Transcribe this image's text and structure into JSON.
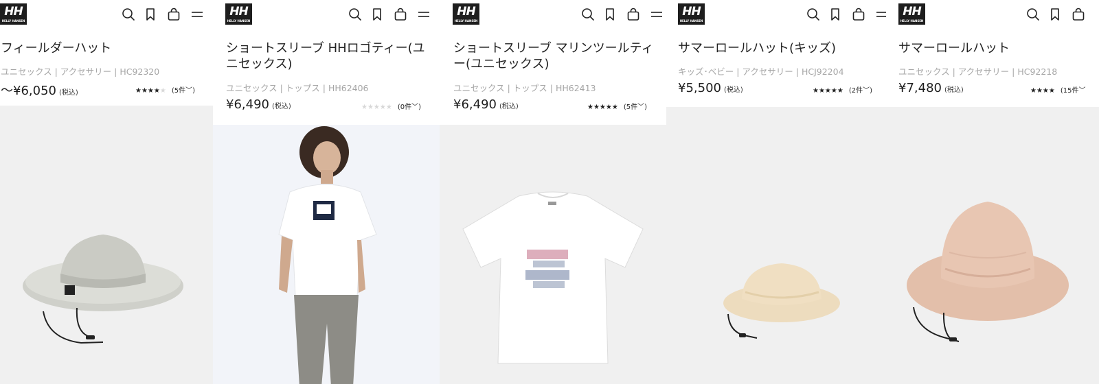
{
  "brand": {
    "logo_text": "HH",
    "logo_sub": "HELLY HANSEN"
  },
  "header_icons": [
    "search-icon",
    "bookmark-icon",
    "bag-icon",
    "menu-icon"
  ],
  "products": [
    {
      "title": "フィールダーハット",
      "meta": "ユニセックス | アクセサリー | HC92320",
      "price": "～¥6,050",
      "tax": "(税込)",
      "stars": "★★★★",
      "stars_empty": "★",
      "rating": 4.5,
      "count": "(5件",
      "image": "bucket hat"
    },
    {
      "title": "ショートスリーブ HHロゴティー(ユニセックス)",
      "meta": "ユニセックス | トップス | HH62406",
      "price": "¥6,490",
      "tax": "(税込)",
      "stars": "",
      "stars_empty": "★★★★★",
      "rating": 0,
      "count": "(0件",
      "image": "model in logo t-shirt"
    },
    {
      "title": "ショートスリーブ マリンツールティー(ユニセックス)",
      "meta": "ユニセックス | トップス | HH62413",
      "price": "¥6,490",
      "tax": "(税込)",
      "stars": "★★★★★",
      "stars_empty": "",
      "rating": 5,
      "count": "(5件",
      "image": "white t-shirt"
    },
    {
      "title": "サマーロールハット(キッズ)",
      "meta": "キッズ･ベビー | アクセサリー | HCJ92204",
      "price": "¥5,500",
      "tax": "(税込)",
      "stars": "★★★★★",
      "stars_empty": "",
      "rating": 5,
      "count": "(2件",
      "image": "kids straw hat"
    },
    {
      "title": "サマーロールハット",
      "meta": "ユニセックス | アクセサリー | HC92218",
      "price": "¥7,480",
      "tax": "(税込)",
      "stars": "★★★★",
      "stars_empty": "",
      "rating": 4.5,
      "count": "(15件",
      "image": "pink straw hat"
    }
  ],
  "colors": {
    "text": "#1a1a1a",
    "meta": "#a6a6a6",
    "background": "#f0f0f0",
    "logo": "#1e1e1e"
  }
}
